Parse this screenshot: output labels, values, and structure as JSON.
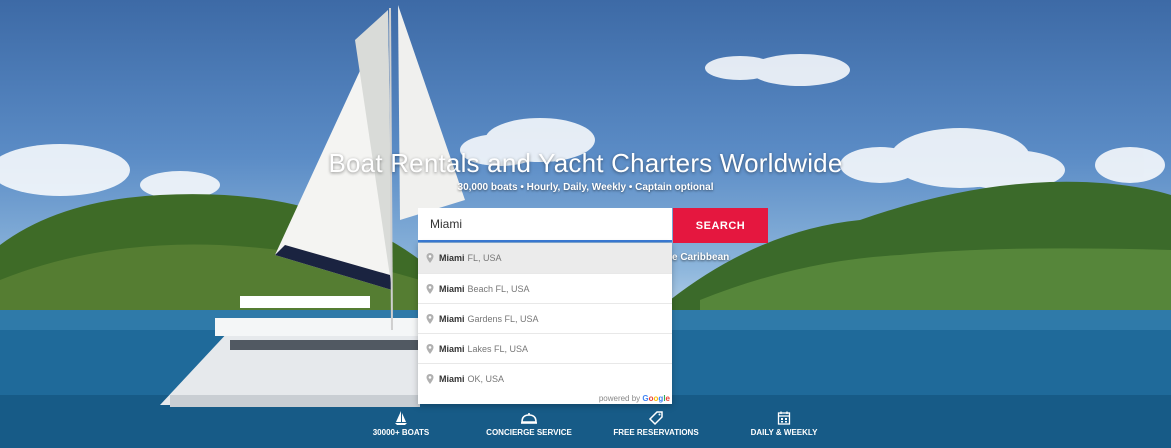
{
  "hero": {
    "title": "Boat Rentals and Yacht Charters Worldwide",
    "subtitle": "30,000 boats • Hourly, Daily, Weekly • Captain optional",
    "partial_text_behind": "e Caribbean"
  },
  "search": {
    "value": "Miami",
    "button_label": "SEARCH"
  },
  "suggestions": [
    {
      "main": "Miami",
      "secondary": "FL, USA"
    },
    {
      "main": "Miami",
      "secondary": "Beach FL, USA"
    },
    {
      "main": "Miami",
      "secondary": "Gardens FL, USA"
    },
    {
      "main": "Miami",
      "secondary": "Lakes FL, USA"
    },
    {
      "main": "Miami",
      "secondary": "OK, USA"
    }
  ],
  "powered_by": {
    "prefix": "powered by",
    "brand_letters": [
      "G",
      "o",
      "o",
      "g",
      "l",
      "e"
    ]
  },
  "features": [
    {
      "label": "30000+ BOATS",
      "icon": "sailboat-icon"
    },
    {
      "label": "CONCIERGE SERVICE",
      "icon": "concierge-bell-icon"
    },
    {
      "label": "FREE RESERVATIONS",
      "icon": "tag-icon"
    },
    {
      "label": "DAILY & WEEKLY",
      "icon": "calendar-icon"
    }
  ],
  "colors": {
    "accent": "#e5173f",
    "input_focus": "#3a7bd5"
  }
}
